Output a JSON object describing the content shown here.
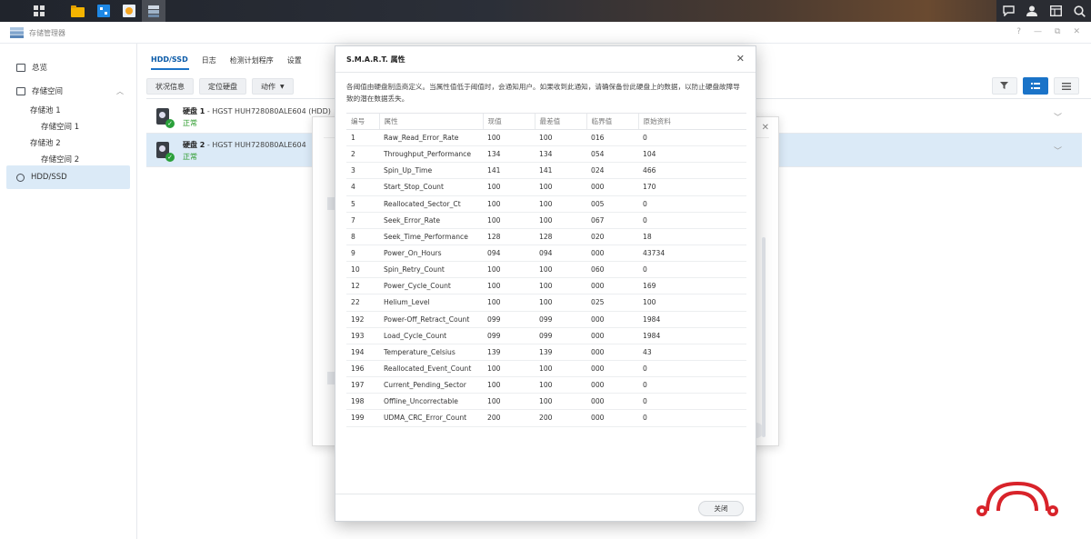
{
  "window": {
    "title": "存储管理器",
    "controls": [
      "?",
      "—",
      "⧉",
      "✕"
    ]
  },
  "sidebar": {
    "items": [
      {
        "label": "总览",
        "icon": "overview-icon"
      },
      {
        "label": "存储空间",
        "icon": "storage-icon"
      },
      {
        "label": "存储池 1"
      },
      {
        "label": "存储空间 1"
      },
      {
        "label": "存储池 2"
      },
      {
        "label": "存储空间 2"
      },
      {
        "label": "HDD/SSD",
        "icon": "hdd-icon"
      }
    ]
  },
  "main": {
    "tabs": [
      "HDD/SSD",
      "日志",
      "检测计划程序",
      "设置"
    ],
    "toolbar": {
      "status": "状况信息",
      "locate": "定位硬盘",
      "action": "动作"
    },
    "disks": [
      {
        "name": "硬盘 1",
        "model": " - HGST HUH728080ALE604 (HDD)",
        "status": "正常"
      },
      {
        "name": "硬盘 2",
        "model": " - HGST HUH728080ALE604",
        "status": "正常"
      }
    ]
  },
  "dialog": {
    "title": "S.M.A.R.T. 属性",
    "description": "各阈值由硬盘制造商定义。当属性值低于阈值时，会通知用户。如果收到此通知，请确保备份此硬盘上的数据，以防止硬盘故障导致的潜在数据丢失。",
    "columns": [
      "编号",
      "属性",
      "现值",
      "最差值",
      "临界值",
      "原始资料"
    ],
    "rows": [
      [
        "1",
        "Raw_Read_Error_Rate",
        "100",
        "100",
        "016",
        "0"
      ],
      [
        "2",
        "Throughput_Performance",
        "134",
        "134",
        "054",
        "104"
      ],
      [
        "3",
        "Spin_Up_Time",
        "141",
        "141",
        "024",
        "466"
      ],
      [
        "4",
        "Start_Stop_Count",
        "100",
        "100",
        "000",
        "170"
      ],
      [
        "5",
        "Reallocated_Sector_Ct",
        "100",
        "100",
        "005",
        "0"
      ],
      [
        "7",
        "Seek_Error_Rate",
        "100",
        "100",
        "067",
        "0"
      ],
      [
        "8",
        "Seek_Time_Performance",
        "128",
        "128",
        "020",
        "18"
      ],
      [
        "9",
        "Power_On_Hours",
        "094",
        "094",
        "000",
        "43734"
      ],
      [
        "10",
        "Spin_Retry_Count",
        "100",
        "100",
        "060",
        "0"
      ],
      [
        "12",
        "Power_Cycle_Count",
        "100",
        "100",
        "000",
        "169"
      ],
      [
        "22",
        "Helium_Level",
        "100",
        "100",
        "025",
        "100"
      ],
      [
        "192",
        "Power-Off_Retract_Count",
        "099",
        "099",
        "000",
        "1984"
      ],
      [
        "193",
        "Load_Cycle_Count",
        "099",
        "099",
        "000",
        "1984"
      ],
      [
        "194",
        "Temperature_Celsius",
        "139",
        "139",
        "000",
        "43"
      ],
      [
        "196",
        "Reallocated_Event_Count",
        "100",
        "100",
        "000",
        "0"
      ],
      [
        "197",
        "Current_Pending_Sector",
        "100",
        "100",
        "000",
        "0"
      ],
      [
        "198",
        "Offline_Uncorrectable",
        "100",
        "100",
        "000",
        "0"
      ],
      [
        "199",
        "UDMA_CRC_Error_Count",
        "200",
        "200",
        "000",
        "0"
      ]
    ],
    "close_label": "关闭"
  },
  "colors": {
    "accent": "#1a73c8",
    "selected_bg": "#dbeaf7",
    "ok": "#2aa03a",
    "logo": "#d8232a"
  }
}
